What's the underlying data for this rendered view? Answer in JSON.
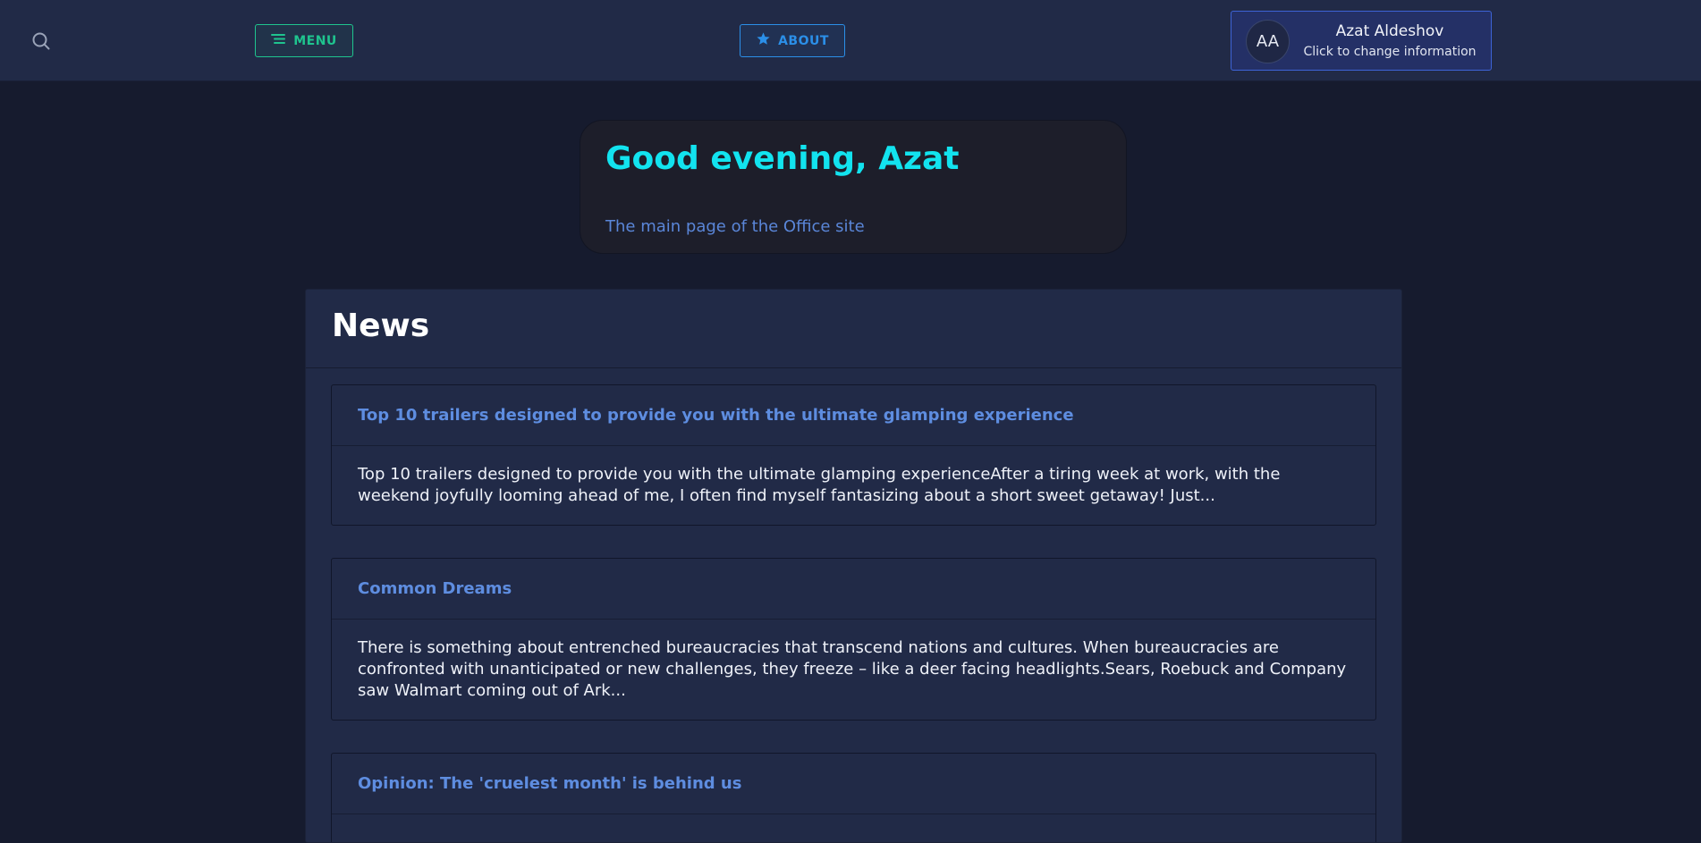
{
  "header": {
    "search_icon": "search-icon",
    "menu_label": "MENU",
    "menu_icon": "hamburger-icon",
    "about_label": "ABOUT",
    "about_icon": "star-icon",
    "user": {
      "initials": "AA",
      "name": "Azat Aldeshov",
      "subtitle": "Click to change information"
    }
  },
  "greeting": {
    "title": "Good evening, Azat",
    "subtitle": "The main page of the Office site"
  },
  "news": {
    "title": "News",
    "items": [
      {
        "title": "Top 10 trailers designed to provide you with the ultimate glamping experience",
        "excerpt": "Top 10 trailers designed to provide you with the ultimate glamping experienceAfter a tiring week at work, with the weekend joyfully looming ahead of me, I often find myself fantasizing about a short sweet getaway! Just..."
      },
      {
        "title": "Common Dreams",
        "excerpt": "There is something about entrenched bureaucracies that transcend nations and cultures. When bureaucracies are confronted with unanticipated or new challenges, they freeze – like a deer facing headlights.Sears, Roebuck and Company saw Walmart coming out of Ark..."
      },
      {
        "title": "Opinion: The 'cruelest month' is behind us",
        "excerpt": ""
      }
    ]
  },
  "colors": {
    "background": "#161b2e",
    "topbar": "#212a47",
    "menu_accent": "#1fc48e",
    "about_accent": "#2b8fe8",
    "greeting_title": "#12e3ef",
    "link": "#5e8de0"
  }
}
